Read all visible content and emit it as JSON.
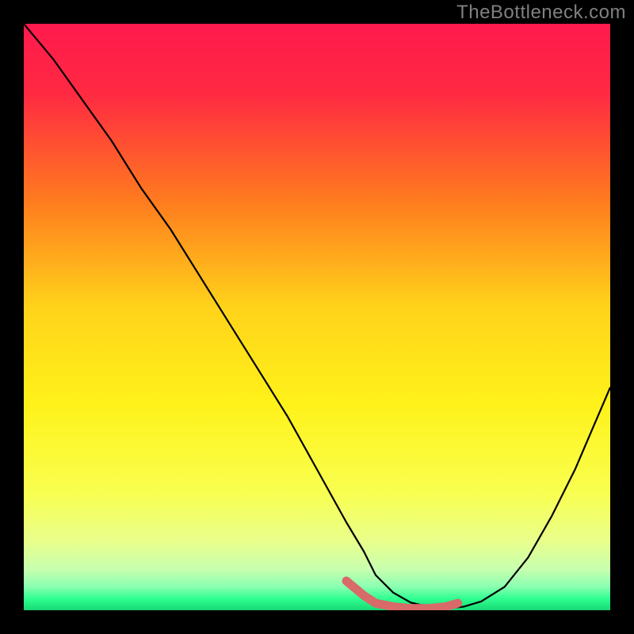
{
  "watermark": "TheBottleneck.com",
  "chart_data": {
    "type": "line",
    "title": "",
    "xlabel": "",
    "ylabel": "",
    "xlim": [
      0,
      100
    ],
    "ylim": [
      0,
      100
    ],
    "gradient_stops": [
      {
        "offset": 0,
        "color": "#ff1a4d"
      },
      {
        "offset": 12,
        "color": "#ff2a42"
      },
      {
        "offset": 30,
        "color": "#ff7a1f"
      },
      {
        "offset": 48,
        "color": "#ffd21a"
      },
      {
        "offset": 65,
        "color": "#fff21a"
      },
      {
        "offset": 80,
        "color": "#f8ff50"
      },
      {
        "offset": 88,
        "color": "#eaff8a"
      },
      {
        "offset": 93,
        "color": "#c8ffaf"
      },
      {
        "offset": 96,
        "color": "#8affb0"
      },
      {
        "offset": 98,
        "color": "#30ff90"
      },
      {
        "offset": 100,
        "color": "#18d975"
      }
    ],
    "series": [
      {
        "name": "curve",
        "stroke": "#000000",
        "stroke_width": 2.2,
        "x": [
          0,
          5,
          10,
          15,
          20,
          25,
          30,
          35,
          40,
          45,
          50,
          55,
          58,
          60,
          63,
          66,
          69,
          72,
          75,
          78,
          82,
          86,
          90,
          94,
          97,
          100
        ],
        "y": [
          100,
          94,
          87,
          80,
          72,
          65,
          57,
          49,
          41,
          33,
          24,
          15,
          10,
          6,
          3,
          1.3,
          0.6,
          0.3,
          0.6,
          1.5,
          4,
          9,
          16,
          24,
          31,
          38
        ]
      },
      {
        "name": "highlight",
        "stroke": "#d86a6a",
        "stroke_width": 11,
        "linecap": "round",
        "x": [
          55,
          58,
          60,
          63,
          66,
          69,
          72,
          74
        ],
        "y": [
          5,
          2.5,
          1.2,
          0.6,
          0.3,
          0.3,
          0.6,
          1.2
        ]
      }
    ]
  }
}
